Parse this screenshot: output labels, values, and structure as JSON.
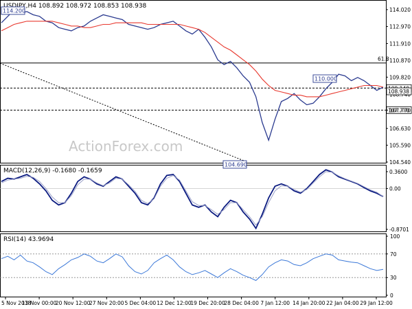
{
  "chart_data": [
    {
      "type": "line",
      "title": "USDJPY,H4 108.892 108.972 108.853 108.938",
      "watermark": "ActionForex.com",
      "ylim": [
        104.54,
        114.02
      ],
      "y_ticks": [
        "114.020",
        "112.970",
        "111.910",
        "110.870",
        "109.820",
        "108.740",
        "107.770",
        "106.630",
        "105.590",
        "104.540"
      ],
      "x_ticks": [
        "5 Nov 2018",
        "13 Nov 00:00",
        "20 Nov 12:00",
        "27 Nov 20:00",
        "5 Dec 04:00",
        "12 Dec 12:00",
        "19 Dec 20:00",
        "28 Dec 04:00",
        "7 Jan 12:00",
        "14 Jan 20:00",
        "22 Jan 04:00",
        "29 Jan 12:00"
      ],
      "fib_label": "61.8",
      "current_price": "108.938",
      "series": [
        {
          "role": "price",
          "color": "#2a3a8f",
          "values": [
            113.2,
            113.6,
            114.0,
            113.8,
            113.9,
            113.7,
            113.6,
            113.3,
            113.2,
            112.9,
            112.8,
            112.7,
            112.9,
            113.0,
            113.3,
            113.5,
            113.7,
            113.6,
            113.5,
            113.4,
            113.1,
            113.0,
            112.9,
            112.8,
            112.9,
            113.1,
            113.2,
            113.3,
            113.0,
            112.7,
            112.5,
            112.8,
            112.3,
            111.7,
            110.9,
            110.6,
            110.8,
            110.4,
            109.9,
            109.5,
            108.6,
            107.0,
            105.9,
            107.2,
            108.3,
            108.5,
            108.8,
            108.4,
            108.1,
            108.2,
            108.6,
            109.1,
            109.5,
            110.0,
            109.9,
            109.6,
            109.8,
            109.6,
            109.3,
            109.0,
            109.2
          ]
        },
        {
          "role": "ma",
          "color": "#e8392f",
          "values": [
            112.7,
            112.9,
            113.1,
            113.2,
            113.3,
            113.3,
            113.3,
            113.3,
            113.3,
            113.2,
            113.1,
            113.0,
            113.0,
            112.9,
            112.9,
            113.0,
            113.1,
            113.1,
            113.2,
            113.2,
            113.2,
            113.2,
            113.2,
            113.1,
            113.1,
            113.1,
            113.1,
            113.1,
            113.1,
            113.0,
            112.9,
            112.8,
            112.6,
            112.3,
            112.0,
            111.7,
            111.5,
            111.2,
            110.9,
            110.6,
            110.2,
            109.7,
            109.3,
            109.0,
            108.9,
            108.8,
            108.7,
            108.7,
            108.6,
            108.6,
            108.6,
            108.7,
            108.8,
            108.9,
            109.0,
            109.1,
            109.2,
            109.3,
            109.3,
            109.3,
            109.2
          ]
        }
      ],
      "levels": [
        {
          "value": 110.7,
          "style": "solid",
          "label": ""
        },
        {
          "value": 109.14,
          "style": "dashed",
          "label": "109.140"
        },
        {
          "value": 107.77,
          "style": "dashed",
          "label": "107.770"
        }
      ],
      "annotations": [
        "114.200",
        "110.000",
        "104.690"
      ]
    },
    {
      "type": "line",
      "title": "MACD(12,26,9) -0.1680 -0.1659",
      "ylim": [
        -0.8701,
        0.36
      ],
      "y_ticks": [
        "0.3600",
        "0.00",
        "-0.8701"
      ],
      "series": [
        {
          "role": "macd",
          "color": "#0a1a80",
          "values": [
            0.15,
            0.22,
            0.2,
            0.25,
            0.3,
            0.22,
            0.1,
            -0.05,
            -0.25,
            -0.35,
            -0.3,
            -0.1,
            0.15,
            0.25,
            0.2,
            0.1,
            0.05,
            0.15,
            0.25,
            0.2,
            0.05,
            -0.1,
            -0.3,
            -0.35,
            -0.2,
            0.1,
            0.28,
            0.3,
            0.15,
            -0.1,
            -0.35,
            -0.4,
            -0.35,
            -0.5,
            -0.6,
            -0.4,
            -0.25,
            -0.3,
            -0.5,
            -0.65,
            -0.85,
            -0.55,
            -0.2,
            0.05,
            0.1,
            0.05,
            -0.05,
            -0.1,
            0.0,
            0.15,
            0.3,
            0.4,
            0.35,
            0.25,
            0.2,
            0.15,
            0.1,
            0.02,
            -0.05,
            -0.1,
            -0.17
          ]
        },
        {
          "role": "signal",
          "color": "#9aa0c8",
          "values": [
            0.12,
            0.18,
            0.2,
            0.22,
            0.26,
            0.24,
            0.15,
            0.0,
            -0.18,
            -0.3,
            -0.3,
            -0.15,
            0.08,
            0.2,
            0.2,
            0.12,
            0.06,
            0.12,
            0.22,
            0.2,
            0.08,
            -0.06,
            -0.25,
            -0.32,
            -0.22,
            0.05,
            0.22,
            0.28,
            0.18,
            -0.05,
            -0.28,
            -0.36,
            -0.36,
            -0.45,
            -0.55,
            -0.45,
            -0.3,
            -0.3,
            -0.45,
            -0.6,
            -0.78,
            -0.6,
            -0.3,
            -0.05,
            0.06,
            0.05,
            -0.02,
            -0.08,
            -0.02,
            0.12,
            0.25,
            0.36,
            0.35,
            0.27,
            0.21,
            0.16,
            0.11,
            0.04,
            -0.03,
            -0.08,
            -0.17
          ]
        }
      ]
    },
    {
      "type": "line",
      "title": "RSI(14) 43.9694",
      "ylim": [
        0,
        100
      ],
      "y_ticks": [
        "100",
        "70",
        "30",
        "0"
      ],
      "series": [
        {
          "role": "rsi",
          "color": "#3b78d8",
          "values": [
            62,
            66,
            60,
            68,
            58,
            55,
            48,
            40,
            35,
            45,
            52,
            60,
            64,
            70,
            66,
            58,
            55,
            62,
            70,
            65,
            50,
            40,
            36,
            42,
            55,
            62,
            68,
            60,
            48,
            40,
            35,
            38,
            42,
            36,
            30,
            38,
            45,
            40,
            34,
            30,
            25,
            35,
            48,
            55,
            60,
            58,
            52,
            50,
            55,
            62,
            66,
            70,
            68,
            60,
            58,
            56,
            55,
            50,
            45,
            42,
            44
          ]
        }
      ],
      "levels": [
        70,
        30
      ]
    }
  ]
}
